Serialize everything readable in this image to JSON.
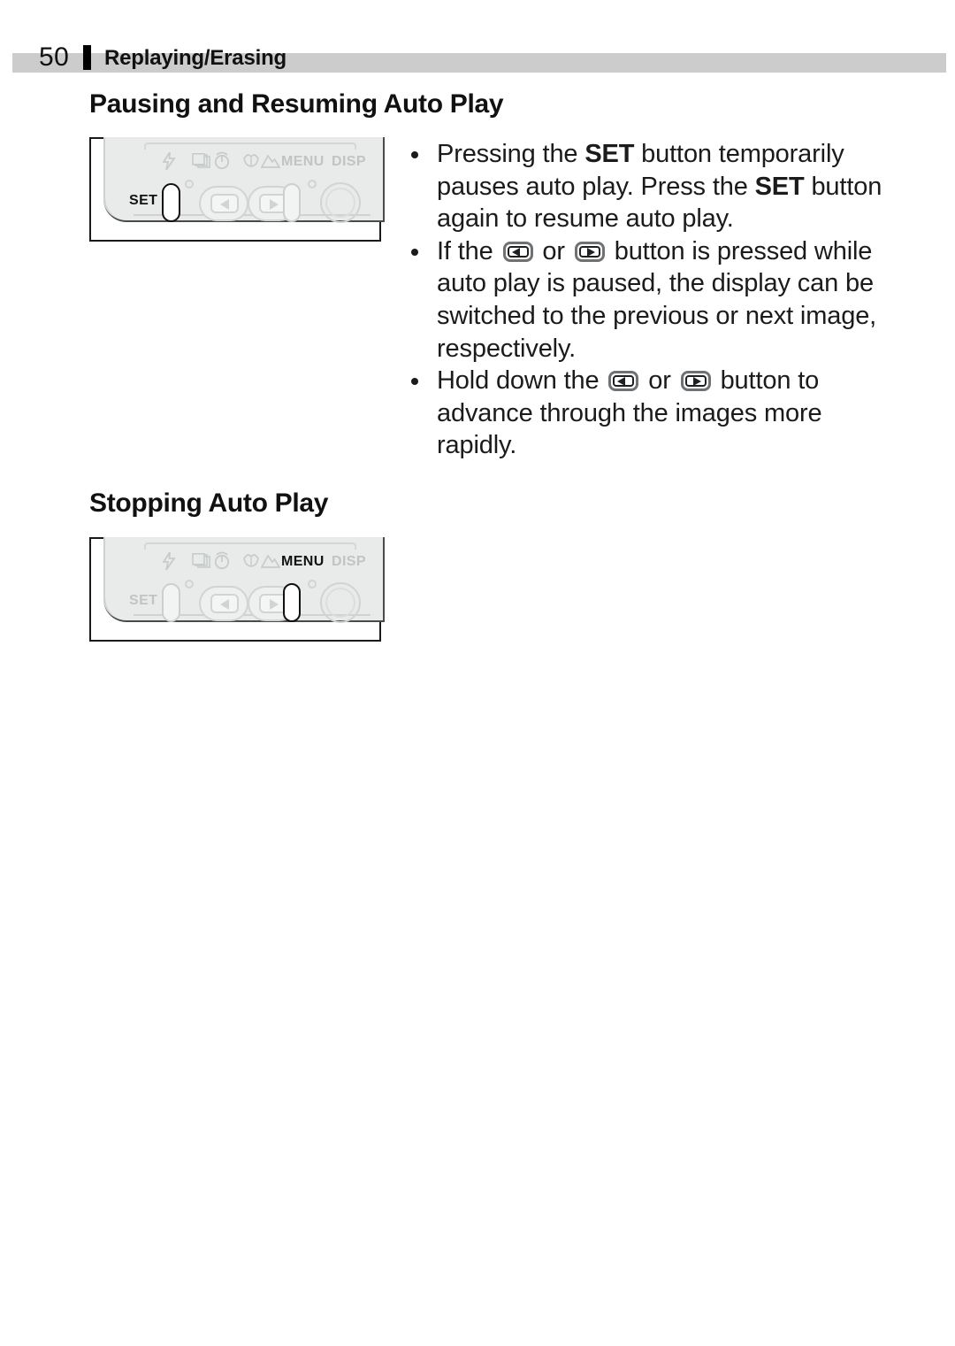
{
  "header": {
    "page_number": "50",
    "chapter_title": "Replaying/Erasing",
    "band_color": "#cccccc"
  },
  "sections": [
    {
      "heading": "Pausing and Resuming Auto Play",
      "figure": {
        "highlighted_control": "SET",
        "set_label": "SET",
        "menu_label": "MENU",
        "disp_label": "DISP",
        "icons": [
          "flash-icon",
          "continuous-shooting-icon",
          "self-timer-icon",
          "macro-icon",
          "landscape-icon"
        ]
      }
    },
    {
      "heading": "Stopping Auto Play",
      "figure": {
        "highlighted_control": "MENU",
        "set_label": "SET",
        "menu_label": "MENU",
        "disp_label": "DISP",
        "icons": [
          "flash-icon",
          "continuous-shooting-icon",
          "self-timer-icon",
          "macro-icon",
          "landscape-icon"
        ]
      }
    }
  ],
  "bullets": [
    {
      "parts": [
        {
          "t": "Pressing the ",
          "s": "normal"
        },
        {
          "t": "SET",
          "s": "bold"
        },
        {
          "t": " button temporarily pauses auto play. Press the ",
          "s": "normal"
        },
        {
          "t": "SET",
          "s": "bold"
        },
        {
          "t": " button again to resume auto play.",
          "s": "normal"
        }
      ]
    },
    {
      "parts": [
        {
          "t": "If the ",
          "s": "normal"
        },
        {
          "t": "",
          "s": "key-left"
        },
        {
          "t": " or ",
          "s": "normal"
        },
        {
          "t": "",
          "s": "key-right"
        },
        {
          "t": " button is pressed while auto play is paused, the display can be switched to the previous or next image, respectively.",
          "s": "normal"
        }
      ]
    },
    {
      "parts": [
        {
          "t": "Hold down the ",
          "s": "normal"
        },
        {
          "t": "",
          "s": "key-left"
        },
        {
          "t": " or ",
          "s": "normal"
        },
        {
          "t": "",
          "s": "key-right"
        },
        {
          "t": " button to advance through the images more rapidly.",
          "s": "normal"
        }
      ]
    }
  ],
  "colors": {
    "text": "#1b1b1b",
    "muted_control": "#c2c4c4",
    "highlight_control": "#121212",
    "camera_body": "#e9eaea"
  }
}
